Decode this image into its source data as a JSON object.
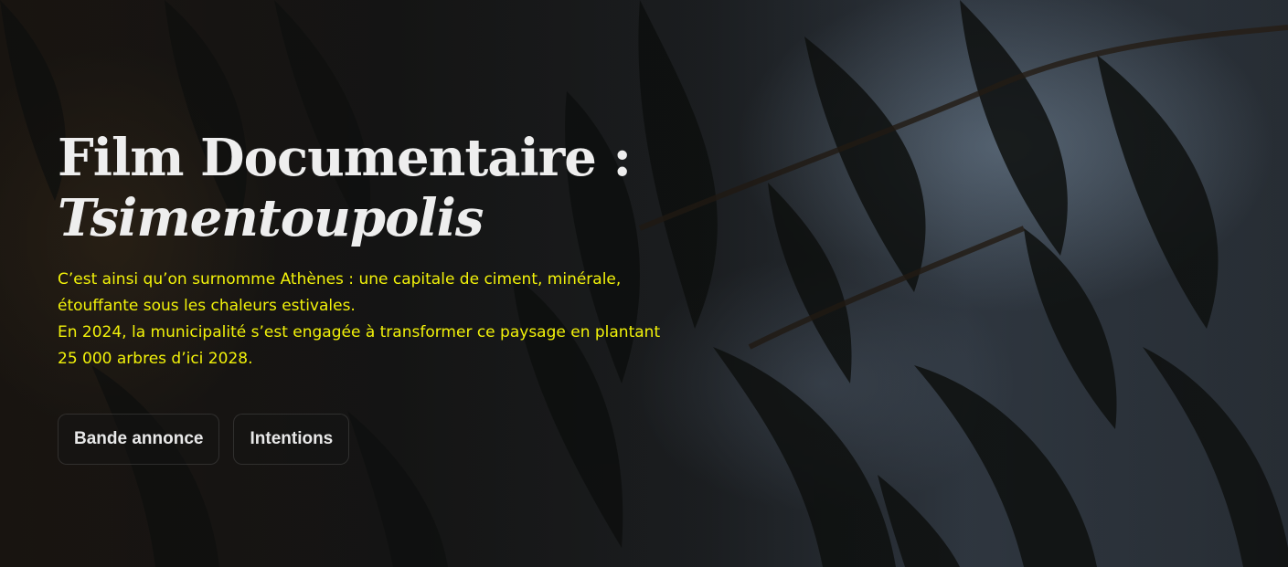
{
  "hero": {
    "title_line1": "Film Documentaire :",
    "title_line2": "Tsimentoupolis",
    "description_line1": "C’est ainsi qu’on surnomme Athènes : une capitale de ciment, minérale, étouffante sous les chaleurs estivales.",
    "description_line2": "En 2024, la municipalité s’est engagée à transformer ce paysage en plantant 25 000 arbres d’ici 2028.",
    "buttons": {
      "trailer_label": "Bande annonce",
      "intentions_label": "Intentions"
    },
    "colors": {
      "title": "#eeeeee",
      "description": "#f2f20a",
      "button_text": "#e8e8e8"
    },
    "background_image": "blurred-olive-tree-foliage"
  }
}
